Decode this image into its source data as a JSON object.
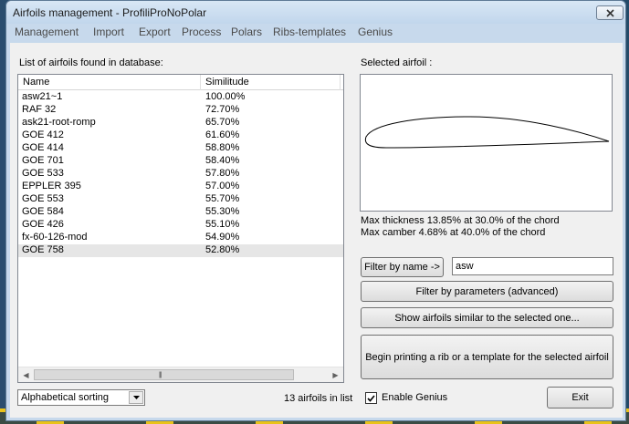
{
  "window": {
    "title": "Airfoils management  -  ProfiliProNoPolar"
  },
  "menu": [
    "Management",
    "Import",
    "Export",
    "Process",
    "Polars",
    "Ribs-templates",
    "Genius"
  ],
  "list": {
    "caption": "List of airfoils found in database:",
    "columns": [
      "Name",
      "Similitude"
    ],
    "rows": [
      [
        "asw21~1",
        "100.00%"
      ],
      [
        "RAF 32",
        "72.70%"
      ],
      [
        "ask21-root-romp",
        "65.70%"
      ],
      [
        "GOE 412",
        "61.60%"
      ],
      [
        "GOE 414",
        "58.80%"
      ],
      [
        "GOE 701",
        "58.40%"
      ],
      [
        "GOE 533",
        "57.80%"
      ],
      [
        "EPPLER 395",
        "57.00%"
      ],
      [
        "GOE 553",
        "55.70%"
      ],
      [
        "GOE 584",
        "55.30%"
      ],
      [
        "GOE 426",
        "55.10%"
      ],
      [
        "fx-60-126-mod",
        "54.90%"
      ],
      [
        "GOE 758",
        "52.80%"
      ]
    ],
    "selected_row": 12
  },
  "sorting": {
    "selected": "Alphabetical sorting"
  },
  "count_text": "13 airfoils in list",
  "preview": {
    "caption": "Selected airfoil :",
    "thickness_text": "Max thickness 13.85% at 30.0% of the chord",
    "camber_text": "Max camber  4.68% at 40.0% of the chord"
  },
  "filter": {
    "by_name_label": "Filter by name ->",
    "name_value": "asw"
  },
  "buttons": {
    "filter_params": "Filter by parameters (advanced)",
    "show_similar": "Show airfoils similar to the selected one...",
    "print_rib": "Begin printing a rib or a template for the selected airfoil",
    "exit": "Exit"
  },
  "genius": {
    "label": "Enable Genius",
    "checked": true
  }
}
